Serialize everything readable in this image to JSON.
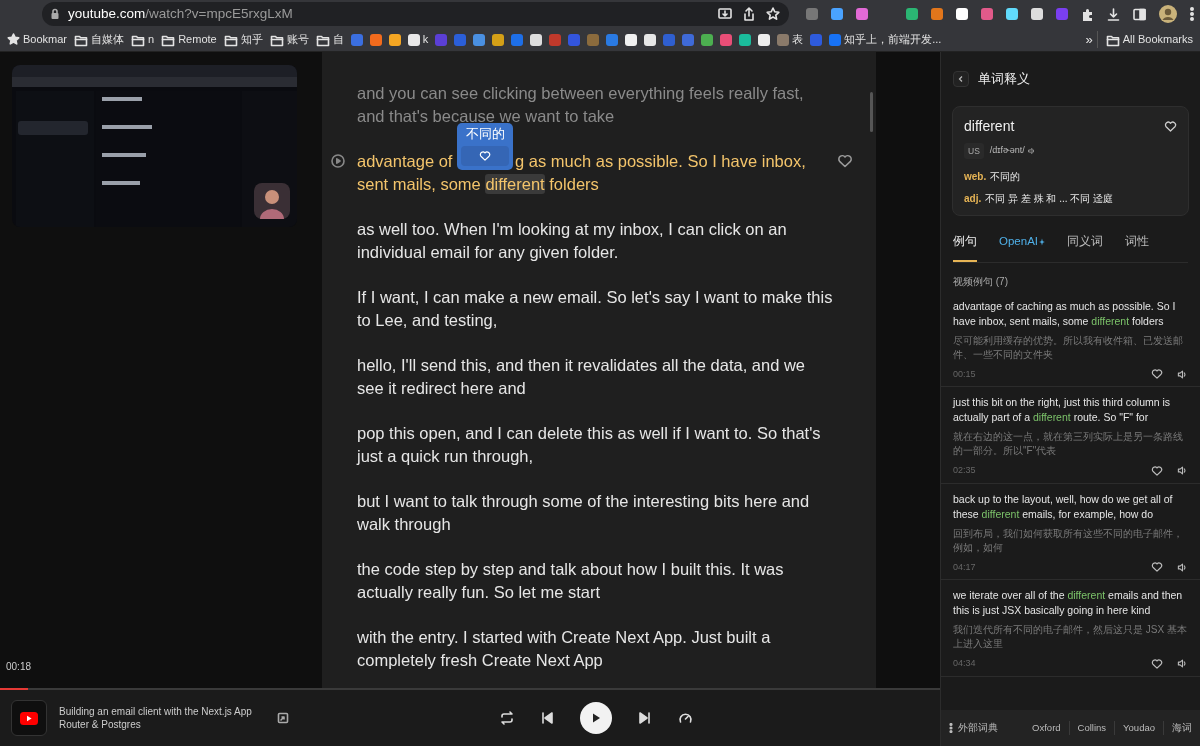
{
  "browser": {
    "url_host": "youtube.com",
    "url_path": "/watch?v=mpcE5rxgLxM"
  },
  "bookmarks": [
    {
      "kind": "star",
      "label": "Bookmar"
    },
    {
      "kind": "folder",
      "label": "自媒体"
    },
    {
      "kind": "folder",
      "label": "n"
    },
    {
      "kind": "folder",
      "label": "Remote"
    },
    {
      "kind": "folder",
      "label": "知乎"
    },
    {
      "kind": "folder",
      "label": "账号"
    },
    {
      "kind": "folder",
      "label": "自"
    },
    {
      "kind": "site",
      "color": "#3b6fe0"
    },
    {
      "kind": "site",
      "color": "#f26b1d"
    },
    {
      "kind": "site",
      "color": "#f5a623"
    },
    {
      "kind": "site",
      "color": "#e8e8e8",
      "label": "k"
    },
    {
      "kind": "site",
      "color": "#5b3fd6"
    },
    {
      "kind": "site",
      "color": "#2b5fd9"
    },
    {
      "kind": "site",
      "color": "#4a90e2"
    },
    {
      "kind": "site",
      "color": "#d4a017"
    },
    {
      "kind": "site",
      "color": "#1e6fe8"
    },
    {
      "kind": "site",
      "color": "#dddddd"
    },
    {
      "kind": "site",
      "color": "#c0392b"
    },
    {
      "kind": "site",
      "color": "#3355dd"
    },
    {
      "kind": "site",
      "color": "#8b6b3d"
    },
    {
      "kind": "site",
      "color": "#2a7ae2"
    },
    {
      "kind": "site",
      "color": "#f0f0f0"
    },
    {
      "kind": "site",
      "color": "#e6e6e6"
    },
    {
      "kind": "site",
      "color": "#2f5fd0"
    },
    {
      "kind": "site",
      "color": "#3f6ad8"
    },
    {
      "kind": "site",
      "color": "#4caf50"
    },
    {
      "kind": "site",
      "color": "#e94e77"
    },
    {
      "kind": "site",
      "color": "#1abc9c"
    },
    {
      "kind": "site",
      "color": "#eeeeee"
    },
    {
      "kind": "site",
      "color": "#8a7a6a",
      "label": "表"
    },
    {
      "kind": "site",
      "color": "#2e5bdc"
    },
    {
      "kind": "site",
      "color": "#1772f6",
      "label": "知乎上，前端开发..."
    },
    {
      "kind": "more",
      "label": "»"
    },
    {
      "kind": "folder",
      "label": "All Bookmarks"
    }
  ],
  "video": {
    "kind": "picture",
    "time": "00:18",
    "progress": {
      "level": 0.03
    }
  },
  "transcript": [
    {
      "kind": "past",
      "text": "and you can see clicking between everything feels really fast, and that's because we want to take"
    },
    {
      "kind": "current",
      "segments": [
        {
          "text": "advantage of "
        },
        {
          "kind": "popup",
          "text": "不同的"
        },
        {
          "text": "g as much as possible. So I have inbox, sent mails, some "
        },
        {
          "text": "different",
          "highlight": true
        },
        {
          "text": " folders"
        }
      ]
    },
    {
      "kind": "upcoming",
      "text": "as well too. When I'm looking at my inbox, I can click on an individual email for any given folder."
    },
    {
      "kind": "upcoming",
      "text": "If I want, I can make a new email. So let's say I want to make this to Lee, and testing,"
    },
    {
      "kind": "upcoming",
      "text": "hello, I'll send this, and then it revalidates all the data, and we see it redirect here and"
    },
    {
      "kind": "upcoming",
      "text": "pop this open, and I can delete this as well if I want to. So that's just a quick run through,"
    },
    {
      "kind": "upcoming",
      "text": "but I want to talk through some of the interesting bits here and walk through"
    },
    {
      "kind": "upcoming",
      "text": "the code step by step and talk about how I built this. It was actually really fun. So let me start"
    },
    {
      "kind": "upcoming",
      "text": "with the entry. I started with Create Next App. Just built a completely fresh Create Next App"
    }
  ],
  "player": {
    "title": "Building an email client with the Next.js App Router & Postgres"
  },
  "panel": {
    "title": "单词释义",
    "word": "different",
    "accent": "US",
    "phonetic": "/dɪfɚənt/",
    "definitions": [
      {
        "pos": "web.",
        "meaning": "不同的"
      },
      {
        "pos": "adj.",
        "meaning": "不同 异 差 殊 和 ... 不同 迳庭"
      }
    ],
    "tabs": [
      {
        "label": "例句",
        "kind": "plain",
        "selected": true
      },
      {
        "label": "OpenAI",
        "kind": "ai",
        "selected": false
      },
      {
        "label": "同义词",
        "kind": "plain",
        "selected": false
      },
      {
        "label": "词性",
        "kind": "plain",
        "selected": false
      }
    ],
    "section": "视频例句 (7)",
    "examples": [
      {
        "before": "advantage of caching as much as possible. So I have inbox, sent mails, some ",
        "word": "different",
        "after": " folders",
        "zh": "尽可能利用缓存的优势。所以我有收件箱、已发送邮件、一些不同的文件夹",
        "time": "00:15"
      },
      {
        "before": "just this bit on the right, just this third column is actually part of a ",
        "word": "different",
        "after": " route. So \"F\" for",
        "zh": "就在右边的这一点，就在第三列实际上是另一条路线的一部分。所以\"F\"代表",
        "time": "02:35"
      },
      {
        "before": "back up to the layout, well, how do we get all of these ",
        "word": "different",
        "after": " emails, for example, how do",
        "zh": "回到布局，我们如何获取所有这些不同的电子邮件，例如，如何",
        "time": "04:17"
      },
      {
        "before": "we iterate over all of the ",
        "word": "different",
        "after": " emails and then this is just JSX basically going in here kind",
        "zh": "我们迭代所有不同的电子邮件，然后这只是 JSX 基本上进入这里",
        "time": "04:34"
      }
    ],
    "footer": {
      "label": "外部词典",
      "links": [
        "Oxford",
        "Collins",
        "Youdao",
        "海词"
      ]
    }
  }
}
